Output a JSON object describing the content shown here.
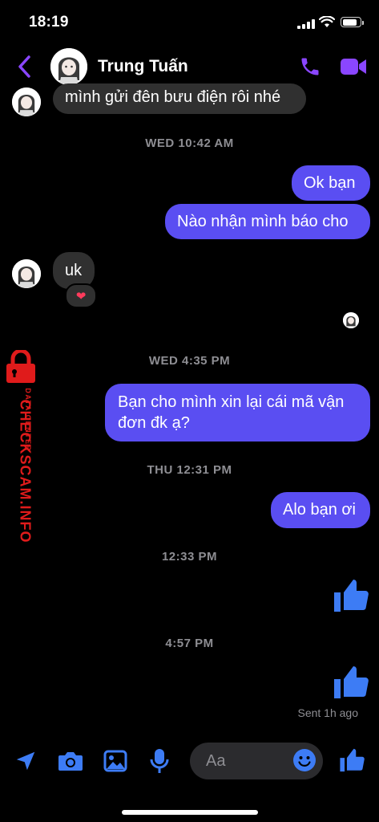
{
  "status_bar": {
    "time": "18:19",
    "battery_level": 0.85
  },
  "header": {
    "contact_name": "Trung Tuấn"
  },
  "conversation": {
    "msg_1": "mình gửi đên bưu điện rôi nhé",
    "ts_1": "WED 10:42 AM",
    "msg_2": "Ok bạn",
    "msg_3": "Nào nhận mình báo cho",
    "msg_4": "uk",
    "reaction_4": "heart",
    "ts_2": "WED 4:35 PM",
    "msg_5": "Bạn cho mình xin lại cái mã vận đơn đk ạ?",
    "ts_3": "THU 12:31 PM",
    "msg_6": "Alo bạn ơi",
    "ts_4": "12:33 PM",
    "ts_5": "4:57 PM",
    "sent_status": "Sent 1h ago"
  },
  "composer": {
    "placeholder": "Aa"
  },
  "watermark": {
    "title": "CHECKSCAM.INFO",
    "subtitle": "DATA CENTER"
  },
  "colors": {
    "accent": "#5a4ef2",
    "icon_purple": "#8a46ff",
    "icon_blue": "#3d7cf5",
    "incoming_bubble": "#303030",
    "watermark_red": "#e01b1b"
  }
}
